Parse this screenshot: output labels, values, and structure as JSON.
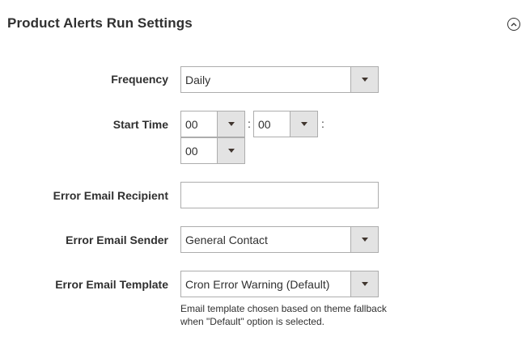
{
  "section": {
    "title": "Product Alerts Run Settings",
    "collapse_icon": "chevron-up-circle-icon"
  },
  "fields": {
    "frequency": {
      "label": "Frequency",
      "value": "Daily"
    },
    "start_time": {
      "label": "Start Time",
      "hour": "00",
      "minute": "00",
      "second": "00",
      "separator": ":"
    },
    "error_email_recipient": {
      "label": "Error Email Recipient",
      "value": ""
    },
    "error_email_sender": {
      "label": "Error Email Sender",
      "value": "General Contact"
    },
    "error_email_template": {
      "label": "Error Email Template",
      "value": "Cron Error Warning (Default)",
      "note": "Email template chosen based on theme fallback when \"Default\" option is selected."
    }
  },
  "colors": {
    "border": "#adadad",
    "arrow_bg": "#e3e3e3",
    "text": "#303030"
  }
}
